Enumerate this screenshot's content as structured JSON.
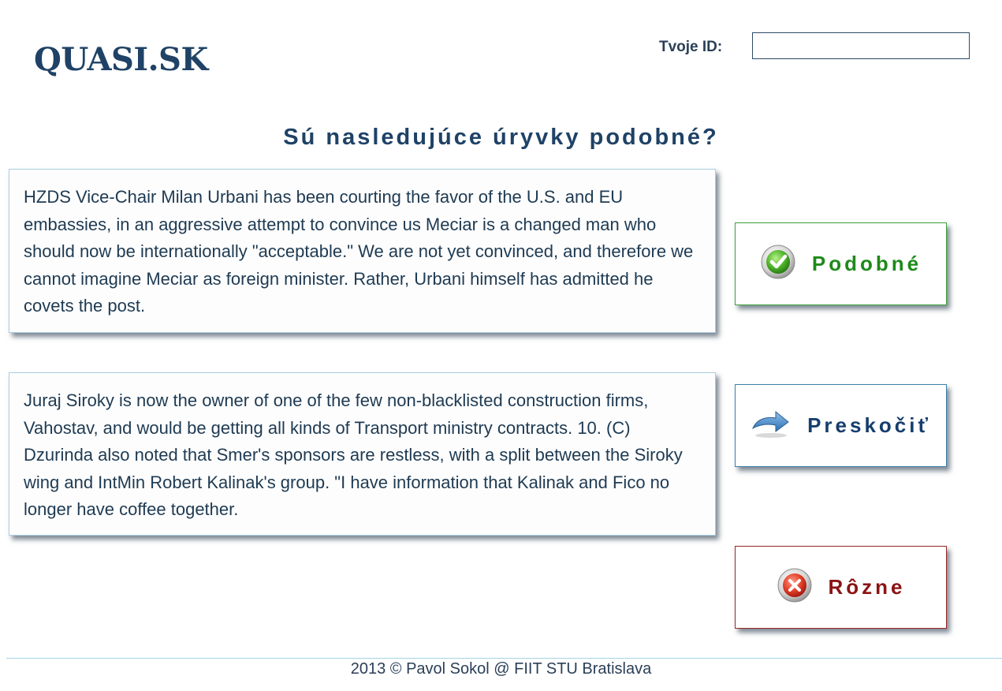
{
  "header": {
    "logo": "QUASI.SK",
    "id_label": "Tvoje ID:",
    "id_value": "",
    "id_placeholder": ""
  },
  "question": "Sú nasledujúce úryvky podobné?",
  "excerpts": [
    "HZDS Vice-Chair Milan Urbani has been courting the favor of the U.S. and EU embassies, in an aggressive attempt to convince us Meciar is a changed man who should now be internationally \"acceptable.\" We are not yet convinced, and therefore we cannot imagine Meciar as foreign minister. Rather, Urbani himself has admitted he covets the post.",
    "Juraj Siroky is now the owner of one of the few non-blacklisted construction firms, Vahostav, and would be getting all kinds of Transport ministry contracts. 10. (C) Dzurinda also noted that Smer's sponsors are restless, with a split between the Siroky wing and IntMin Robert Kalinak's group. \"I have information that Kalinak and Fico no longer have coffee together."
  ],
  "buttons": {
    "similar": {
      "label": "Podobné",
      "icon": "check-icon",
      "color": "#1e8a1a"
    },
    "skip": {
      "label": "Preskočiť",
      "icon": "arrow-right-icon",
      "color": "#163e6e"
    },
    "different": {
      "label": "Rôzne",
      "icon": "x-circle-icon",
      "color": "#8a1414"
    }
  },
  "footer": "2013 © Pavol Sokol @ FIIT STU Bratislava"
}
